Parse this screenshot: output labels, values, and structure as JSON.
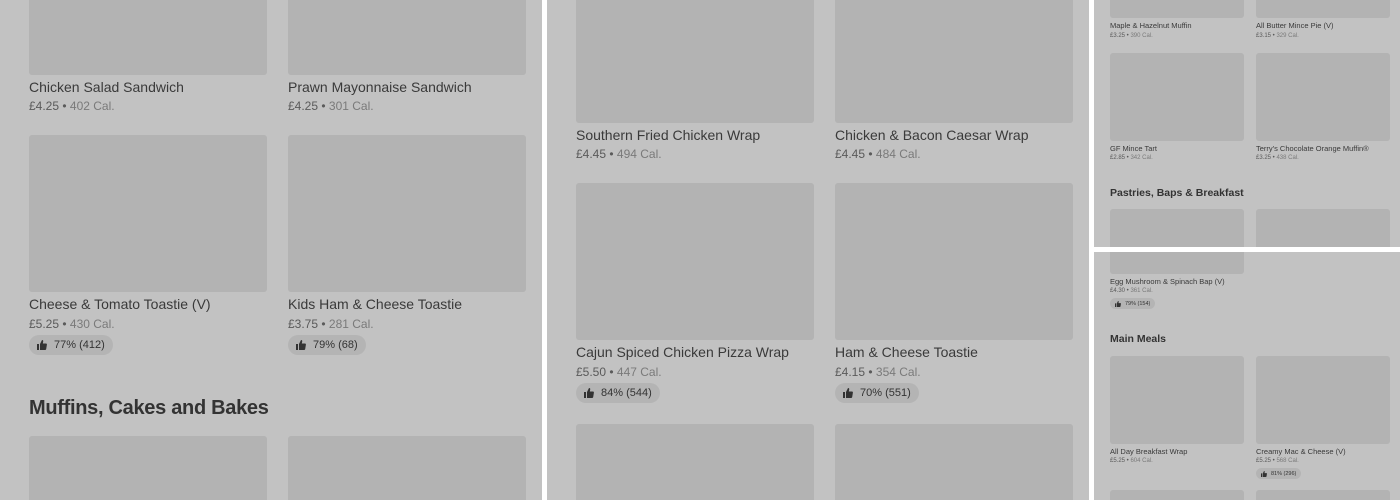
{
  "panel1": {
    "items": [
      {
        "name": "Chicken Salad Sandwich",
        "price": "£4.25",
        "calories": "402 Cal."
      },
      {
        "name": "Prawn Mayonnaise Sandwich",
        "price": "£4.25",
        "calories": "301 Cal."
      },
      {
        "name": "Cheese & Tomato Toastie (V)",
        "price": "£5.25",
        "calories": "430 Cal.",
        "rating": "77% (412)"
      },
      {
        "name": "Kids Ham & Cheese Toastie",
        "price": "£3.75",
        "calories": "281 Cal.",
        "rating": "79% (68)"
      }
    ],
    "section_title": "Muffins, Cakes and Bakes"
  },
  "panel2": {
    "items": [
      {
        "name": "Southern Fried Chicken Wrap",
        "price": "£4.45",
        "calories": "494 Cal."
      },
      {
        "name": "Chicken & Bacon Caesar Wrap",
        "price": "£4.45",
        "calories": "484 Cal."
      },
      {
        "name": "Cajun Spiced Chicken Pizza Wrap",
        "price": "£5.50",
        "calories": "447 Cal.",
        "rating": "84% (544)"
      },
      {
        "name": "Ham & Cheese Toastie",
        "price": "£4.15",
        "calories": "354 Cal.",
        "rating": "70% (551)"
      }
    ]
  },
  "panel3": {
    "items": [
      {
        "name": "Maple & Hazelnut Muffin",
        "price": "£3.25",
        "calories": "390 Cal."
      },
      {
        "name": "All Butter Mince Pie (V)",
        "price": "£3.15",
        "calories": "329 Cal."
      },
      {
        "name": "GF Mince Tart",
        "price": "£2.85",
        "calories": "342 Cal."
      },
      {
        "name": "Terry's Chocolate Orange Muffin®",
        "price": "£3.25",
        "calories": "438 Cal."
      }
    ],
    "section_title": "Pastries, Baps & Breakfast"
  },
  "panel4": {
    "top_item": {
      "name": "Egg Mushroom & Spinach Bap (V)",
      "price": "£4.30",
      "calories": "361 Cal.",
      "rating": "79% (154)"
    },
    "section_title": "Main Meals",
    "items": [
      {
        "name": "All Day Breakfast Wrap",
        "price": "£5.25",
        "calories": "604 Cal."
      },
      {
        "name": "Creamy Mac & Cheese (V)",
        "price": "£5.25",
        "calories": "568 Cal.",
        "rating": "81% (296)"
      }
    ]
  },
  "colors": {
    "overlay": "#c2c2c2",
    "image_placeholder": "#b3b3b3",
    "badge": "#b4b4b4"
  },
  "icons": {
    "rating": "thumbs-up-icon"
  }
}
